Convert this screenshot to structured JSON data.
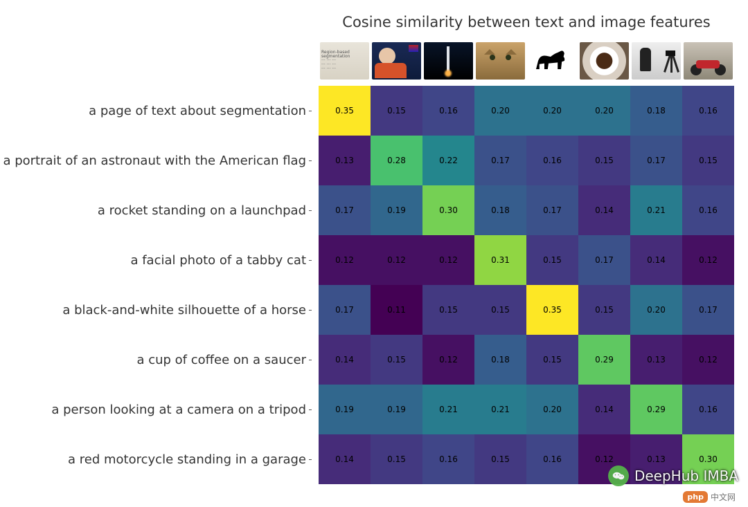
{
  "chart_data": {
    "type": "heatmap",
    "title": "Cosine similarity between text and image features",
    "xlabel": "",
    "ylabel": "",
    "y_categories": [
      "a page of text about segmentation",
      "a portrait of an astronaut with the American flag",
      "a rocket standing on a launchpad",
      "a facial photo of a tabby cat",
      "a black-and-white silhouette of a horse",
      "a cup of coffee on a saucer",
      "a person looking at a camera on a tripod",
      "a red motorcycle standing in a garage"
    ],
    "x_images": [
      "text-page",
      "astronaut",
      "rocket",
      "cat",
      "horse-silhouette",
      "coffee-cup",
      "person-camera",
      "motorcycle"
    ],
    "values": [
      [
        0.35,
        0.15,
        0.16,
        0.2,
        0.2,
        0.2,
        0.18,
        0.16
      ],
      [
        0.13,
        0.28,
        0.22,
        0.17,
        0.16,
        0.15,
        0.17,
        0.15
      ],
      [
        0.17,
        0.19,
        0.3,
        0.18,
        0.17,
        0.14,
        0.21,
        0.16
      ],
      [
        0.12,
        0.12,
        0.12,
        0.31,
        0.15,
        0.17,
        0.14,
        0.12
      ],
      [
        0.17,
        0.11,
        0.15,
        0.15,
        0.35,
        0.15,
        0.2,
        0.17
      ],
      [
        0.14,
        0.15,
        0.12,
        0.18,
        0.15,
        0.29,
        0.13,
        0.12
      ],
      [
        0.19,
        0.19,
        0.21,
        0.21,
        0.2,
        0.14,
        0.29,
        0.16
      ],
      [
        0.14,
        0.15,
        0.16,
        0.15,
        0.16,
        0.12,
        0.13,
        0.3
      ]
    ],
    "value_range": [
      0.11,
      0.35
    ],
    "colormap": "viridis"
  },
  "watermark": {
    "icon": "wechat",
    "text": "DeepHub IMBA",
    "php_pill": "php",
    "php_cn": "中文网"
  }
}
